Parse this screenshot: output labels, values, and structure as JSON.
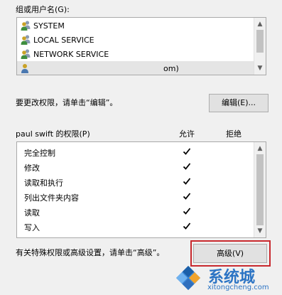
{
  "groups_label": "组或用户名(G):",
  "users": [
    {
      "name": "SYSTEM",
      "icon": "users-group-icon"
    },
    {
      "name": "LOCAL SERVICE",
      "icon": "users-group-icon"
    },
    {
      "name": "NETWORK SERVICE",
      "icon": "users-group-icon"
    },
    {
      "name": "om)",
      "icon": "user-icon"
    }
  ],
  "change_hint": "要更改权限，请单击“编辑”。",
  "edit_button": "编辑(E)...",
  "permissions_for": "paul swift 的权限(P)",
  "allow_header": "允许",
  "deny_header": "拒绝",
  "permissions": [
    {
      "name": "完全控制",
      "allow": true,
      "deny": false
    },
    {
      "name": "修改",
      "allow": true,
      "deny": false
    },
    {
      "name": "读取和执行",
      "allow": true,
      "deny": false
    },
    {
      "name": "列出文件夹内容",
      "allow": true,
      "deny": false
    },
    {
      "name": "读取",
      "allow": true,
      "deny": false
    },
    {
      "name": "写入",
      "allow": true,
      "deny": false
    }
  ],
  "advanced_hint": "有关特殊权限或高级设置，请单击“高级”。",
  "advanced_button": "高级(V)",
  "watermark": {
    "title": "系统城",
    "url": "xitongcheng.com",
    "color": "#2c74c4"
  },
  "colors": {
    "selected_row": "#e5e5e5",
    "highlight_border": "#c8282d"
  }
}
